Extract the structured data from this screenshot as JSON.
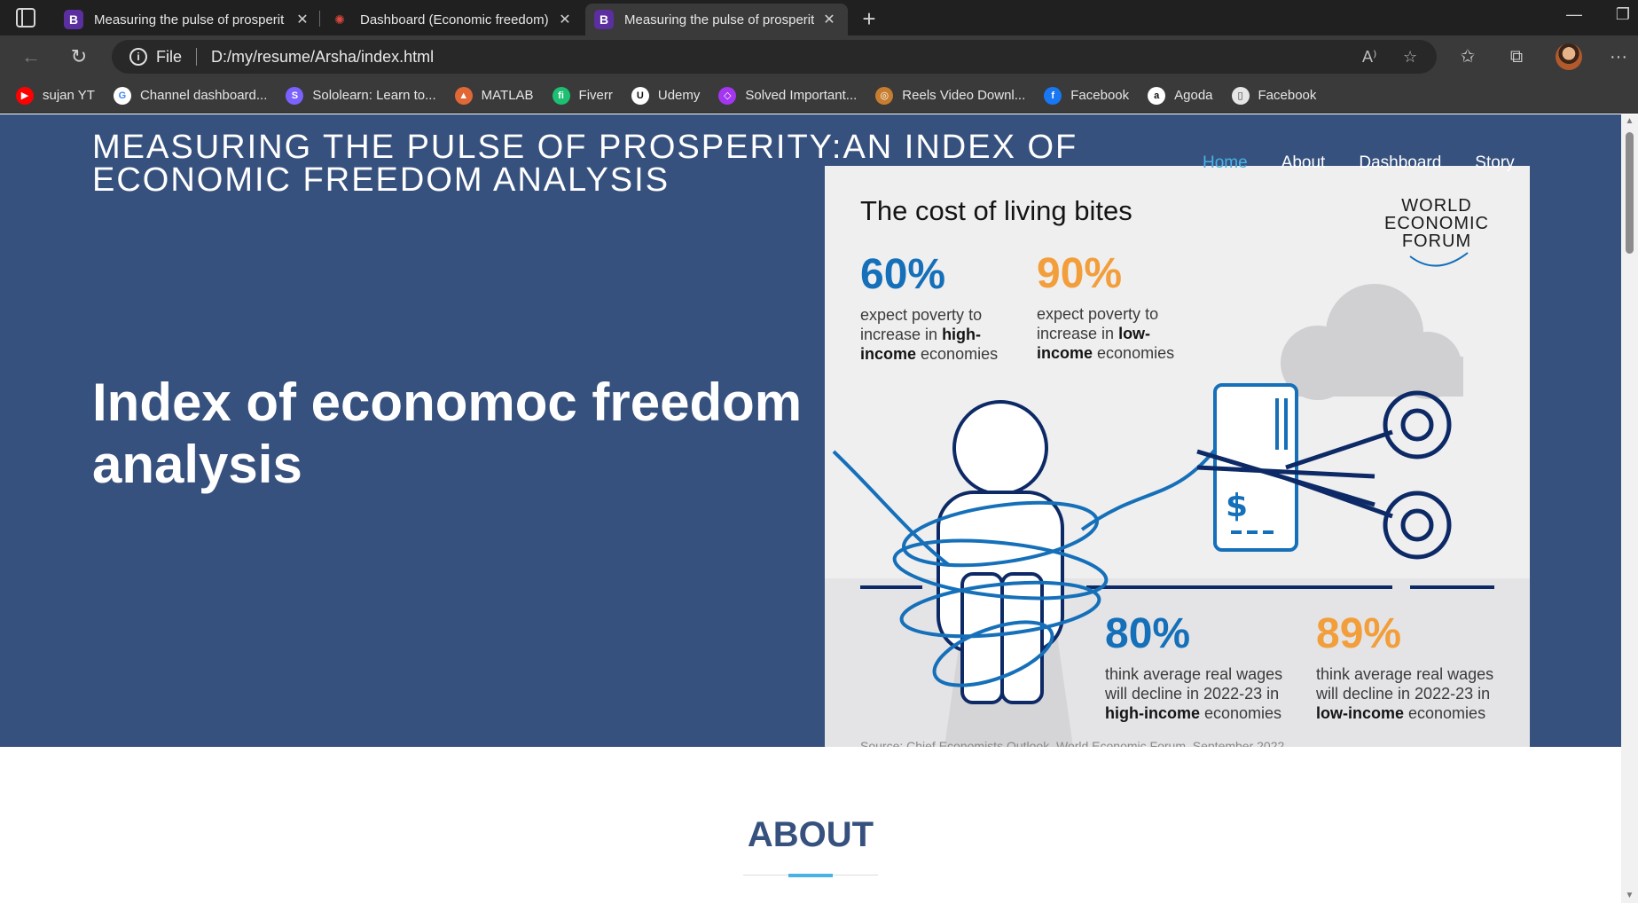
{
  "browser": {
    "tabs": [
      {
        "favicon": "B",
        "title": "Measuring the pulse of prosperit",
        "active": false
      },
      {
        "favicon": "sparkle-icon",
        "title": "Dashboard (Economic freedom) |",
        "active": false
      },
      {
        "favicon": "B",
        "title": "Measuring the pulse of prosperit",
        "active": true
      }
    ],
    "address": {
      "scheme_label": "File",
      "url": "D:/my/resume/Arsha/index.html"
    },
    "bookmarks": [
      {
        "label": "sujan YT",
        "icon": "youtube-icon",
        "color": "#ff0000"
      },
      {
        "label": "Channel dashboard...",
        "icon": "google-icon",
        "color": "#ffffff"
      },
      {
        "label": "Sololearn: Learn to...",
        "icon": "sololearn-icon",
        "color": "#7b61ff"
      },
      {
        "label": "MATLAB",
        "icon": "matlab-icon",
        "color": "#e16737"
      },
      {
        "label": "Fiverr",
        "icon": "fiverr-icon",
        "color": "#1dbf73"
      },
      {
        "label": "Udemy",
        "icon": "udemy-icon",
        "color": "#ffffff"
      },
      {
        "label": "Solved Important...",
        "icon": "bookmark-icon",
        "color": "#a435f0"
      },
      {
        "label": "Reels Video Downl...",
        "icon": "instagram-icon",
        "color": "#c77d2f"
      },
      {
        "label": "Facebook",
        "icon": "facebook-icon",
        "color": "#1877f2"
      },
      {
        "label": "Agoda",
        "icon": "agoda-icon",
        "color": "#ffffff"
      },
      {
        "label": "Facebook",
        "icon": "page-icon",
        "color": "#e6e6e6"
      }
    ]
  },
  "site": {
    "title": "MEASURING THE PULSE OF PROSPERITY:AN INDEX OF ECONOMIC FREEDOM ANALYSIS",
    "nav": [
      "Home",
      "About",
      "Dashboard",
      "Story"
    ],
    "hero_heading": "Index of economoc freedom analysis",
    "about_title": "ABOUT"
  },
  "infographic": {
    "title": "The cost of living bites",
    "logo_lines": [
      "WORLD",
      "ECONOMIC",
      "FORUM"
    ],
    "stats": [
      {
        "pct": "60%",
        "text_pre": "expect poverty to increase in ",
        "bold": "high-income",
        "text_post": " economies",
        "color": "blue"
      },
      {
        "pct": "90%",
        "text_pre": "expect poverty to increase in ",
        "bold": "low-income",
        "text_post": " economies",
        "color": "orange"
      },
      {
        "pct": "80%",
        "text_pre": "think average real wages will decline in 2022-23 in ",
        "bold": "high-income",
        "text_post": " economies",
        "color": "blue"
      },
      {
        "pct": "89%",
        "text_pre": "think average real wages will decline in 2022-23 in ",
        "bold": "low-income",
        "text_post": " economies",
        "color": "orange"
      }
    ],
    "source": "Source: Chief Economists Outlook, World Economic Forum, September 2022"
  },
  "colors": {
    "hero_bg": "#37517e",
    "accent": "#47b2e4",
    "wef_blue": "#1570b9",
    "wef_orange": "#f29e3a",
    "wef_navy": "#0d2a66"
  }
}
